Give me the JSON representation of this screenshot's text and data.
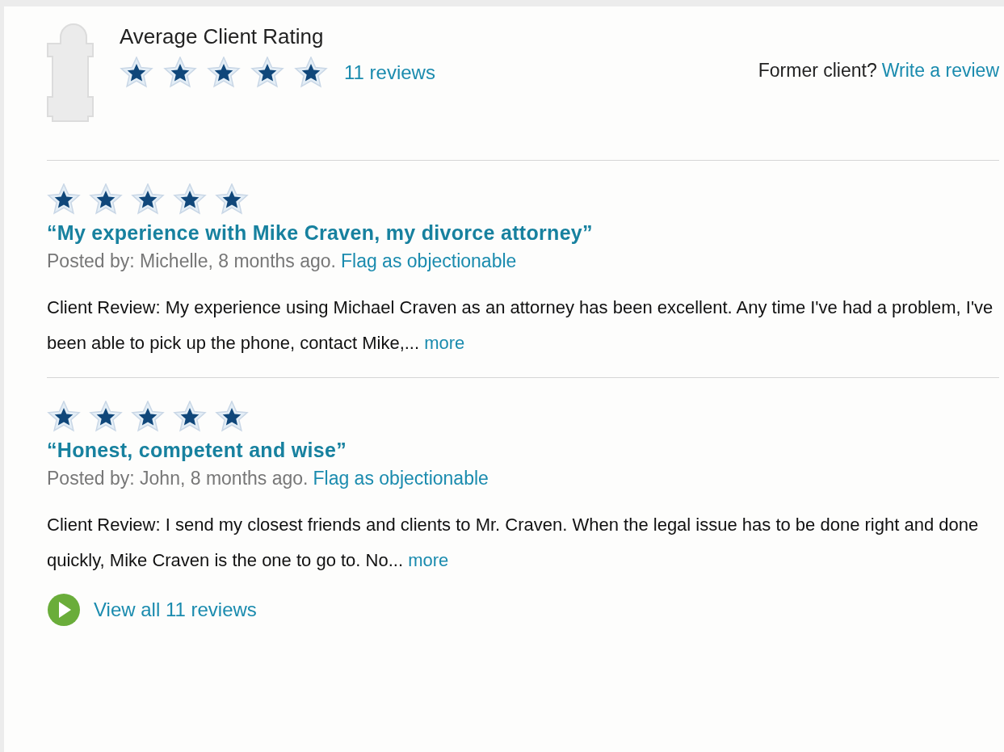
{
  "summary": {
    "title": "Average Client Rating",
    "stars": 5,
    "reviews_link": "11 reviews",
    "former_client": "Former client?",
    "write_review": "Write a review"
  },
  "reviews": [
    {
      "stars": 5,
      "title": "“My experience with Mike Craven, my divorce attorney”",
      "posted": "Posted by: Michelle, 8 months ago.",
      "flag": "Flag as objectionable",
      "body": "Client Review: My experience using Michael Craven as an attorney has been excellent. Any time I've had a problem, I've been able to pick up the phone, contact Mike,...",
      "more": "more"
    },
    {
      "stars": 5,
      "title": "“Honest, competent and wise”",
      "posted": "Posted by: John, 8 months ago.",
      "flag": "Flag as objectionable",
      "body": "Client Review: I send my closest friends and clients to Mr. Craven. When the legal issue has to be done right and done quickly, Mike Craven is the one to go to. No...",
      "more": "more"
    }
  ],
  "view_all": "View all 11 reviews"
}
